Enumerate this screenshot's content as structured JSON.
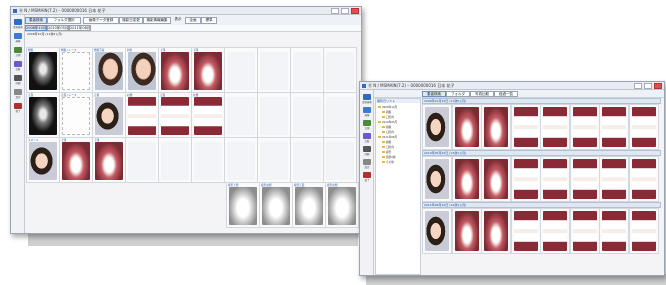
{
  "left_window": {
    "title": "Ⓡ N / MSMAIN(7.2) – 0000000016 日本 花子",
    "ribbon_buttons": [
      "患者検索",
      "フォルダ選択",
      "画像データ登録",
      "撮影日変更",
      "撮影情報編集"
    ],
    "view_options": [
      "表示",
      "全画",
      "標準"
    ],
    "tabs": [
      "2008年10月",
      "2010年05月",
      "2011年08月"
    ],
    "info_line": "2008年10月 (11歳6ヵ月)",
    "sidebar_items": [
      {
        "label": "患者検索",
        "icon": "search-icon",
        "color": "#2d6cc0"
      },
      {
        "label": "画像",
        "icon": "photo-icon",
        "color": "#3a7bd5"
      },
      {
        "label": "計測",
        "icon": "ruler-icon",
        "color": "#4a8a3a"
      },
      {
        "label": "比較",
        "icon": "compare-icon",
        "color": "#6a5acd"
      },
      {
        "label": "印刷",
        "icon": "print-icon",
        "color": "#555555"
      },
      {
        "label": "設定",
        "icon": "gear-icon",
        "color": "#888888"
      },
      {
        "label": "終了",
        "icon": "exit-icon",
        "color": "#b03030"
      }
    ],
    "section_labels": [
      "顔貌",
      "口腔内写真",
      "頭部X線",
      "模型写真"
    ],
    "cells": [
      {
        "label": "側貌",
        "kind": "xray"
      },
      {
        "label": "側貌トレース",
        "kind": "trace"
      },
      {
        "label": "側貌写真",
        "kind": "face"
      },
      {
        "label": "斜位",
        "kind": "face"
      },
      {
        "label": "上顎",
        "kind": "teeth"
      },
      {
        "label": "下顎",
        "kind": "teeth"
      },
      {
        "label": "正面",
        "kind": "xray"
      },
      {
        "label": "正面トレース",
        "kind": "trace"
      },
      {
        "label": "正貌",
        "kind": "face2"
      },
      {
        "label": "右側",
        "kind": "teeth-front"
      },
      {
        "label": "正面",
        "kind": "teeth-front"
      },
      {
        "label": "左側",
        "kind": "teeth-front"
      },
      {
        "label": "スマイル",
        "kind": "face2"
      },
      {
        "label": "上顎",
        "kind": "teeth"
      },
      {
        "label": "下顎",
        "kind": "teeth"
      },
      {
        "label": "模型上顎",
        "kind": "model"
      },
      {
        "label": "模型右側",
        "kind": "model"
      },
      {
        "label": "模型正面",
        "kind": "model"
      },
      {
        "label": "模型左側",
        "kind": "model"
      }
    ]
  },
  "right_window": {
    "title": "Ⓡ N / MSMAIN(7.2) – 0000000016 日本 花子",
    "ribbon_buttons": [
      "患者検索",
      "フォルダ",
      "写真比較",
      "経過一覧"
    ],
    "tree_title": "撮影日リスト",
    "tree_items": [
      "2008年10月",
      "顔貌",
      "口腔内",
      "2010年05月",
      "顔貌",
      "口腔内",
      "2011年08月",
      "顔貌",
      "口腔内",
      "模型",
      "頭部X線",
      "その他"
    ],
    "rows": [
      {
        "header": "2008年10月15日 (11歳6ヵ月)"
      },
      {
        "header": "2010年05月20日 (13歳1ヵ月)"
      },
      {
        "header": "2011年08月10日 (14歳4ヵ月)"
      }
    ],
    "row_thumbs": [
      "face2",
      "teeth",
      "teeth",
      "teeth-front",
      "teeth-front",
      "teeth-front",
      "teeth-front",
      "teeth-front"
    ]
  }
}
